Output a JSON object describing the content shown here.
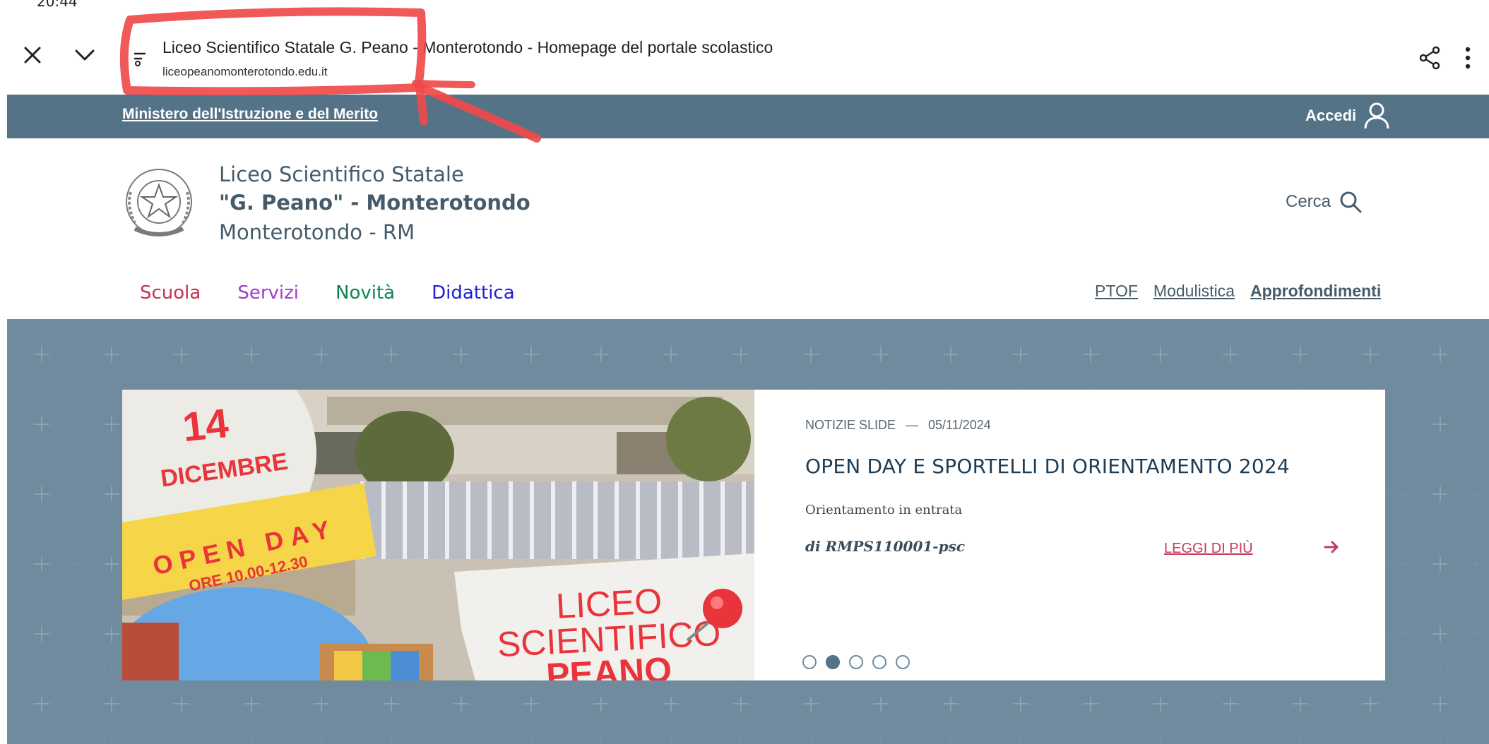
{
  "status_bar": {
    "clock": "20:44"
  },
  "browser": {
    "page_title": "Liceo Scientifico Statale G. Peano - Monterotondo - Homepage del portale scolastico",
    "url": "liceopeanomonterotondo.edu.it",
    "icons": [
      "close-icon",
      "chevron-down-icon",
      "site-settings-icon",
      "share-icon",
      "more-vert-icon"
    ],
    "annotation_color": "#f04a4a"
  },
  "slim_header": {
    "ministry": "Ministero dell'Istruzione e del Merito",
    "login": "Accedi"
  },
  "brand": {
    "line1": "Liceo Scientifico Statale",
    "line2": "\"G. Peano\" - Monterotondo",
    "line3": "Monterotondo - RM"
  },
  "search": {
    "label": "Cerca"
  },
  "nav_main": [
    {
      "label": "Scuola",
      "color": "#c8314f"
    },
    {
      "label": "Servizi",
      "color": "#a23ad0"
    },
    {
      "label": "Novità",
      "color": "#0d8552"
    },
    {
      "label": "Didattica",
      "color": "#1f1fd6"
    }
  ],
  "nav_secondary": [
    {
      "label": "PTOF"
    },
    {
      "label": "Modulistica"
    },
    {
      "label": "Approfondimenti"
    }
  ],
  "slide": {
    "category": "NOTIZIE SLIDE",
    "separator": "—",
    "date": "05/11/2024",
    "title": "OPEN DAY E SPORTELLI DI ORIENTAMENTO 2024",
    "subtitle": "Orientamento in entrata",
    "author": "di RMPS110001-psc",
    "read_more": "LEGGI DI PIÙ",
    "image": {
      "day": "14",
      "month": "DICEMBRE",
      "event": "OPEN DAY",
      "hours": "ORE 10.00-12.30",
      "school_l1": "LICEO",
      "school_l2": "SCIENTIFICO",
      "school_l3": "PEANO"
    },
    "dots": {
      "total": 5,
      "active_index": 1
    }
  },
  "colors": {
    "slim_bg": "#557387",
    "hero_bg": "#6f8b9d",
    "brand_text": "#465b6a",
    "accent_red": "#c53a5c"
  }
}
